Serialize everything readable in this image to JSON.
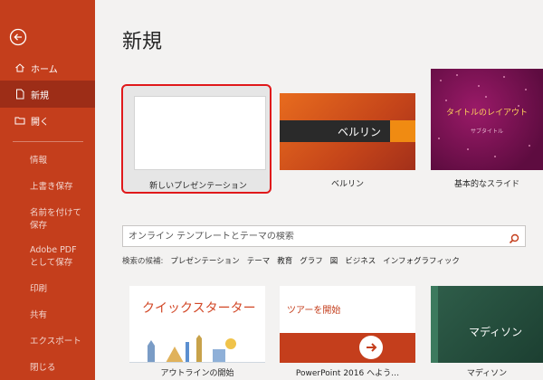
{
  "sidebar": {
    "back_label": "戻る",
    "items": [
      {
        "label": "ホーム",
        "icon": "home-icon"
      },
      {
        "label": "新規",
        "icon": "new-document-icon"
      },
      {
        "label": "開く",
        "icon": "open-folder-icon"
      }
    ],
    "sub_items": [
      {
        "label": "情報"
      },
      {
        "label": "上書き保存"
      },
      {
        "label": "名前を付けて保存"
      },
      {
        "label": "Adobe PDF として保存"
      },
      {
        "label": "印刷"
      },
      {
        "label": "共有"
      },
      {
        "label": "エクスポート"
      },
      {
        "label": "閉じる"
      }
    ],
    "accent_color": "#c43e1c",
    "active_color": "#9d2d17"
  },
  "main": {
    "title": "新規",
    "templates": [
      {
        "label": "新しいプレゼンテーション",
        "selected": true
      },
      {
        "label": "ベルリン",
        "thumb_text": "ベルリン"
      },
      {
        "label": "基本的なスライド",
        "thumb_title": "タイトルのレイアウト",
        "thumb_subtitle": "サブタイトル"
      }
    ],
    "search": {
      "placeholder": "オンライン テンプレートとテーマの検索"
    },
    "suggestions": {
      "lead": "検索の候補:",
      "items": [
        "プレゼンテーション",
        "テーマ",
        "教育",
        "グラフ",
        "図",
        "ビジネス",
        "インフォグラフィック"
      ]
    },
    "featured": [
      {
        "label": "アウトラインの開始",
        "thumb_text": "クイックスターター"
      },
      {
        "label": "PowerPoint 2016 へよう…",
        "thumb_text": "ツアーを開始"
      },
      {
        "label": "マディソン",
        "thumb_text": "マディソン"
      }
    ]
  }
}
